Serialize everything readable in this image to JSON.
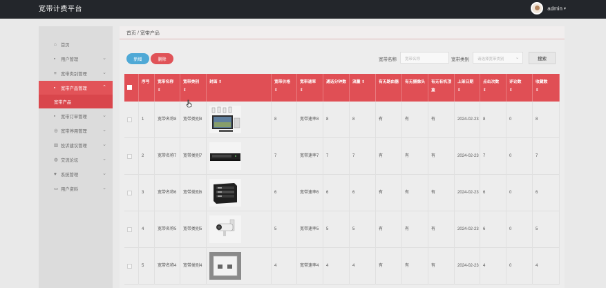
{
  "header": {
    "app_title": "宽带计费平台",
    "username": "admin",
    "caret": "▾"
  },
  "sidebar": {
    "items": [
      {
        "label": "首页",
        "icon": "⌂",
        "expandable": false
      },
      {
        "label": "用户管理",
        "icon": "▪",
        "expandable": true
      },
      {
        "label": "宽带类别管理",
        "icon": "≡",
        "expandable": true
      },
      {
        "label": "宽带产品管理",
        "icon": "▪",
        "expandable": true,
        "active": true
      },
      {
        "label": "宽带订单管理",
        "icon": "▪",
        "expandable": true
      },
      {
        "label": "宽带停用管理",
        "icon": "◎",
        "expandable": true
      },
      {
        "label": "投诉建议管理",
        "icon": "▥",
        "expandable": true
      },
      {
        "label": "交流论坛",
        "icon": "◍",
        "expandable": true
      },
      {
        "label": "系统管理",
        "icon": "♥",
        "expandable": true
      },
      {
        "label": "用户资料",
        "icon": "▭",
        "expandable": true
      }
    ],
    "sub_active": "宽带产品",
    "chevron_down": "⌄",
    "chevron_up": "⌃"
  },
  "breadcrumb": "首页 / 宽带产品",
  "toolbar": {
    "add_label": "新增",
    "delete_label": "删除",
    "name_label": "宽带名称",
    "name_placeholder": "宽带名称",
    "category_label": "宽带类别",
    "category_placeholder": "请选择宽带类别",
    "search_label": "搜索"
  },
  "table": {
    "headers": [
      "",
      "序号",
      "宽带名称",
      "宽带类别",
      "封面",
      "宽带价格",
      "宽带速率",
      "通话分钟数",
      "流量",
      "有无路由器",
      "有无摄像头",
      "有无有机顶盒",
      "上架日期",
      "点击次数",
      "评论数",
      "收藏数"
    ],
    "sort_mark": "⇕",
    "rows": [
      {
        "no": "1",
        "name": "宽带名称8",
        "category": "宽带类别8",
        "cover": "camera-kit",
        "price": "8",
        "rate": "宽带速率8",
        "minutes": "8",
        "traffic": "8",
        "router": "有",
        "camera": "有",
        "stb": "有",
        "date": "2024-02-23",
        "clicks": "8",
        "comments": "0",
        "favorites": "8"
      },
      {
        "no": "2",
        "name": "宽带名称7",
        "category": "宽带类别7",
        "cover": "network-switch",
        "price": "7",
        "rate": "宽带速率7",
        "minutes": "7",
        "traffic": "7",
        "router": "有",
        "camera": "有",
        "stb": "有",
        "date": "2024-02-23",
        "clicks": "7",
        "comments": "0",
        "favorites": "7"
      },
      {
        "no": "3",
        "name": "宽带名称6",
        "category": "宽带类别6",
        "cover": "server-rack",
        "price": "6",
        "rate": "宽带速率6",
        "minutes": "6",
        "traffic": "6",
        "router": "有",
        "camera": "有",
        "stb": "有",
        "date": "2024-02-23",
        "clicks": "6",
        "comments": "0",
        "favorites": "6"
      },
      {
        "no": "4",
        "name": "宽带名称5",
        "category": "宽带类别5",
        "cover": "security-camera",
        "price": "5",
        "rate": "宽带速率5",
        "minutes": "5",
        "traffic": "5",
        "router": "有",
        "camera": "有",
        "stb": "有",
        "date": "2024-02-23",
        "clicks": "6",
        "comments": "0",
        "favorites": "5"
      },
      {
        "no": "5",
        "name": "宽带名称4",
        "category": "宽带类别4",
        "cover": "wall-outlet",
        "price": "4",
        "rate": "宽带速率4",
        "minutes": "4",
        "traffic": "4",
        "router": "有",
        "camera": "有",
        "stb": "有",
        "date": "2024-02-23",
        "clicks": "4",
        "comments": "0",
        "favorites": "4"
      }
    ]
  },
  "colors": {
    "accent": "#e04f55",
    "topbar": "#23262b",
    "add_button": "#4fa9d6"
  }
}
